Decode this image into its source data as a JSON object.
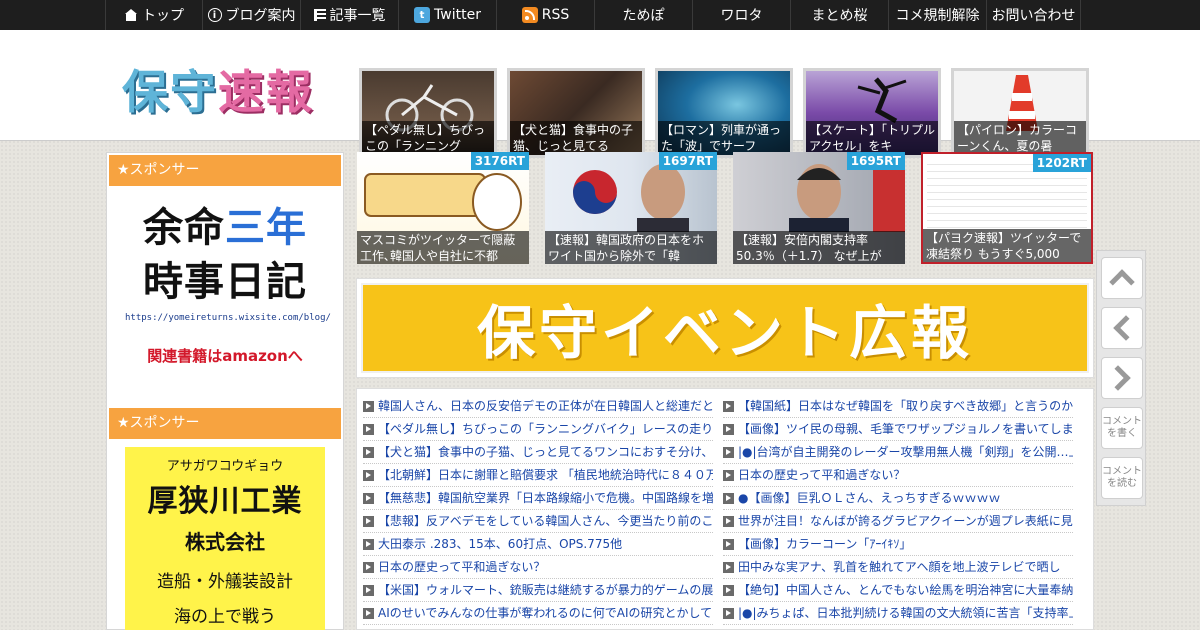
{
  "nav": {
    "items": [
      {
        "label": "トップ",
        "icon": "home-icon"
      },
      {
        "label": "ブログ案内",
        "icon": "info-icon"
      },
      {
        "label": "記事一覧",
        "icon": "list-icon"
      },
      {
        "label": "Twitter",
        "icon": "twitter-icon"
      },
      {
        "label": "RSS",
        "icon": "rss-icon"
      },
      {
        "label": "ためぽ",
        "icon": ""
      },
      {
        "label": "ワロタ",
        "icon": ""
      },
      {
        "label": "まとめ桜",
        "icon": ""
      },
      {
        "label": "コメ規制解除",
        "icon": ""
      },
      {
        "label": "お問い合わせ",
        "icon": ""
      }
    ]
  },
  "header": {
    "logo": [
      "保",
      "守",
      "速",
      "報"
    ],
    "featured": [
      "【ペダル無し】ちびっこの「ランニング",
      "【犬と猫】食事中の子猫、じっと見てる",
      "【ロマン】列車が通った「波」でサーフ",
      "【スケート】「トリプルアクセル」をキ",
      "【パイロン】カラーコーンくん、夏の暑"
    ]
  },
  "sidebar": {
    "sponsor_label": "★スポンサー",
    "ad1": {
      "line1a": "余命",
      "line1b": "三年",
      "line2": "時事日記",
      "url": "https://yomeireturns.wixsite.com/blog/",
      "amazon": "関連書籍はamazonへ"
    },
    "ad2": {
      "kana": "アサガワコウギョウ",
      "name": "厚狭川工業",
      "corp": "株式会社",
      "desc": "造船・外艤装設計",
      "more": "海の上で戦う"
    }
  },
  "rt_items": [
    {
      "badge": "3176RT",
      "caption": "マスコミがツイッターで隠蔽工作､韓国人や自社に不都"
    },
    {
      "badge": "1697RT",
      "caption": "【速報】韓国政府の日本をホワイト国から除外で「韓"
    },
    {
      "badge": "1695RT",
      "caption": "【速報】安倍内閣支持率50.3％（＋1.7） なぜ上が"
    },
    {
      "badge": "1202RT",
      "caption": "【パヨク速報】ツイッターで凍結祭り もうすぐ5,000"
    }
  ],
  "banner": {
    "text": "保守イベント広報"
  },
  "articles": {
    "left": [
      "韓国人さん、日本の反安倍デモの正体が在日韓国人と総連だと",
      "【ペダル無し】ちびっこの「ランニングバイク」レースの走り",
      "【犬と猫】食事中の子猫、じっと見てるワンコにおすそ分け、",
      "【北朝鮮】日本に謝罪と賠償要求 「植民地統治時代に８４０万",
      "【無慈悲】韓国航空業界「日本路線縮小で危機。中国路線を増",
      "【悲報】反アベデモをしている韓国人さん、今更当たり前のこ",
      "大田泰示 .283、15本、60打点、OPS.775他",
      "日本の歴史って平和過ぎない？",
      "【米国】ウォルマート、銃販売は継続するが暴力的ゲームの展",
      "AIのせいでみんなの仕事が奪われるのに何でAIの研究とかして"
    ],
    "right": [
      "【韓国紙】日本はなぜ韓国を「取り戻すべき故郷」と言うのか",
      "【画像】ツイ民の母親、毛筆でワザップジョルノを書いてしま",
      "|●|台湾が自主開発のレーダー攻撃用無人機「剣翔」を公開…上",
      "日本の歴史って平和過ぎない？",
      "●【画像】巨乳ＯＬさん、えっちすぎるｗｗｗｗ",
      "世界が注目！なんばが誇るグラビアクイーンが週プレ表紙に見",
      "【画像】カラーコーン「ｱｰｲｷｿ」",
      "田中みな実アナ、乳首を触れてアヘ顔を地上波テレビで晒し",
      "【絶句】中国人さん、とんでもない絵馬を明治神宮に大量奉納",
      "|●|みちょぱ、日本批判続ける韓国の文大統領に苦言「支持率上"
    ]
  },
  "float_side": {
    "comment_write": "コメントを書く",
    "comment_read": "コメントを読む"
  },
  "colors": {
    "accent": "#f7a340",
    "link": "#1a46a8",
    "rt_badge": "#29a3d9",
    "banner": "#f7c318"
  }
}
